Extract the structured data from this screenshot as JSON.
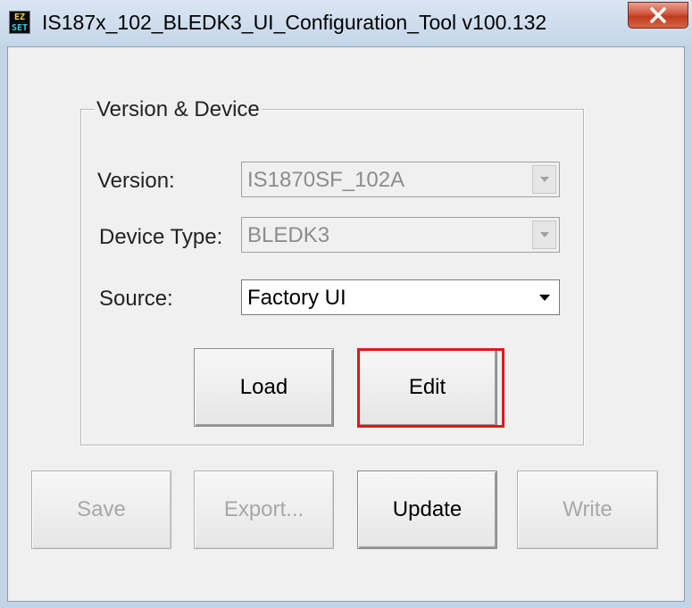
{
  "window": {
    "title": "IS187x_102_BLEDK3_UI_Configuration_Tool v100.132",
    "icon_text_top": "EZ",
    "icon_text_bottom": "SET",
    "close_icon": "close-icon"
  },
  "group": {
    "label": "Version & Device"
  },
  "fields": {
    "version": {
      "label": "Version:",
      "value": "IS1870SF_102A",
      "enabled": false
    },
    "device_type": {
      "label": "Device Type:",
      "value": "BLEDK3",
      "enabled": false
    },
    "source": {
      "label": "Source:",
      "value": "Factory UI",
      "enabled": true
    }
  },
  "buttons": {
    "load": {
      "label": "Load",
      "enabled": true
    },
    "edit": {
      "label": "Edit",
      "enabled": true,
      "highlighted": true
    },
    "save": {
      "label": "Save",
      "enabled": false
    },
    "export": {
      "label": "Export...",
      "enabled": false
    },
    "update": {
      "label": "Update",
      "enabled": true
    },
    "write": {
      "label": "Write",
      "enabled": false
    }
  },
  "colors": {
    "highlight": "#e01818",
    "disabled_text": "#a8a8a8",
    "close_button": "#c94a2e"
  }
}
